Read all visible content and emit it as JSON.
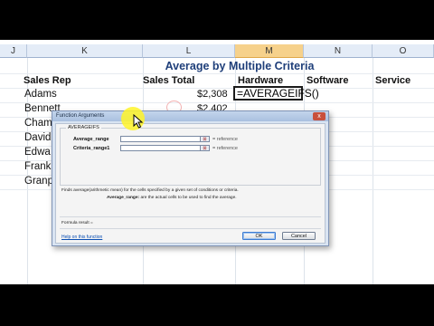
{
  "columns": [
    {
      "letter": "J",
      "selected": false
    },
    {
      "letter": "K",
      "selected": false
    },
    {
      "letter": "L",
      "selected": false
    },
    {
      "letter": "M",
      "selected": true
    },
    {
      "letter": "N",
      "selected": false
    },
    {
      "letter": "O",
      "selected": false
    }
  ],
  "sheet": {
    "title": "Average by Multiple Criteria",
    "headers": {
      "sales_rep": "Sales Rep",
      "sales_total": "Sales Total",
      "hardware": "Hardware",
      "software": "Software",
      "service": "Service"
    },
    "reps": [
      "Adams",
      "Bennett",
      "Cham",
      "David",
      "Edwa",
      "Frank",
      "Granp"
    ],
    "totals": [
      "$2,308",
      "$2,402"
    ],
    "active_cell_formula": "=AVERAGEIFS()"
  },
  "dialog": {
    "title": "Function Arguments",
    "close_label": "x",
    "function_name": "AVERAGEIFS",
    "args": [
      {
        "label": "Average_range",
        "result": "= reference"
      },
      {
        "label": "Criteria_range1",
        "result": "= reference"
      }
    ],
    "description": "Finds average(arithmetic mean) for the cells specified by a given set of conditions or criteria.",
    "arg_desc_name": "Average_range:",
    "arg_desc_text": "are the actual cells to be used to find the average.",
    "formula_result": "Formula result =",
    "help_link": "Help on this function",
    "ok_label": "OK",
    "cancel_label": "Cancel"
  },
  "icons": {
    "collapse": "collapse-dialog-icon",
    "cursor": "mouse-pointer-icon"
  },
  "colors": {
    "title": "#1f3f7a",
    "selected_col": "#f6d18b",
    "highlight": "#fff528"
  }
}
